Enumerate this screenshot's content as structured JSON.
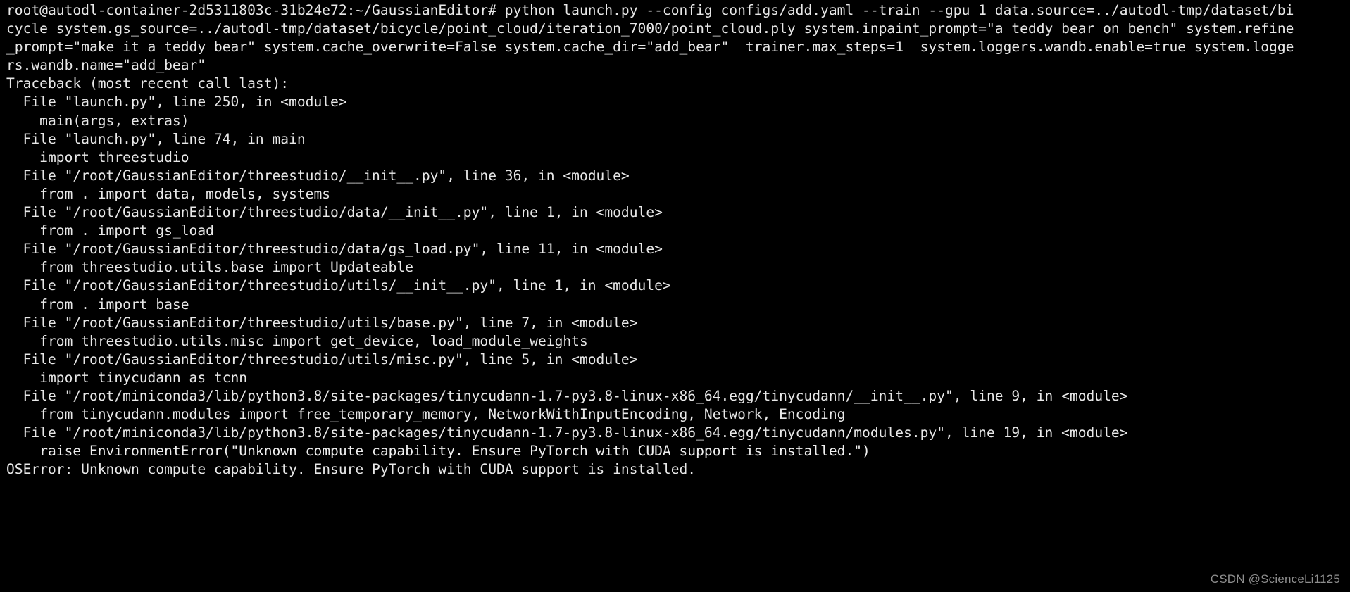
{
  "terminal": {
    "background_color": "#000000",
    "text_color": "#e8e8e8",
    "prompt": "root@autodl-container-2d5311803c-31b24e72:~/GaussianEditor#",
    "lines": [
      "root@autodl-container-2d5311803c-31b24e72:~/GaussianEditor# python launch.py --config configs/add.yaml --train --gpu 1 data.source=../autodl-tmp/dataset/bi",
      "cycle system.gs_source=../autodl-tmp/dataset/bicycle/point_cloud/iteration_7000/point_cloud.ply system.inpaint_prompt=\"a teddy bear on bench\" system.refine",
      "_prompt=\"make it a teddy bear\" system.cache_overwrite=False system.cache_dir=\"add_bear\"  trainer.max_steps=1  system.loggers.wandb.enable=true system.logge",
      "rs.wandb.name=\"add_bear\"",
      "Traceback (most recent call last):",
      "  File \"launch.py\", line 250, in <module>",
      "    main(args, extras)",
      "  File \"launch.py\", line 74, in main",
      "    import threestudio",
      "  File \"/root/GaussianEditor/threestudio/__init__.py\", line 36, in <module>",
      "    from . import data, models, systems",
      "  File \"/root/GaussianEditor/threestudio/data/__init__.py\", line 1, in <module>",
      "    from . import gs_load",
      "  File \"/root/GaussianEditor/threestudio/data/gs_load.py\", line 11, in <module>",
      "    from threestudio.utils.base import Updateable",
      "  File \"/root/GaussianEditor/threestudio/utils/__init__.py\", line 1, in <module>",
      "    from . import base",
      "  File \"/root/GaussianEditor/threestudio/utils/base.py\", line 7, in <module>",
      "    from threestudio.utils.misc import get_device, load_module_weights",
      "  File \"/root/GaussianEditor/threestudio/utils/misc.py\", line 5, in <module>",
      "    import tinycudann as tcnn",
      "  File \"/root/miniconda3/lib/python3.8/site-packages/tinycudann-1.7-py3.8-linux-x86_64.egg/tinycudann/__init__.py\", line 9, in <module>",
      "    from tinycudann.modules import free_temporary_memory, NetworkWithInputEncoding, Network, Encoding",
      "  File \"/root/miniconda3/lib/python3.8/site-packages/tinycudann-1.7-py3.8-linux-x86_64.egg/tinycudann/modules.py\", line 19, in <module>",
      "    raise EnvironmentError(\"Unknown compute capability. Ensure PyTorch with CUDA support is installed.\")",
      "OSError: Unknown compute capability. Ensure PyTorch with CUDA support is installed."
    ],
    "error_line_index": 24,
    "command": {
      "program": "python",
      "script": "launch.py",
      "config_flag": "--config",
      "config_value": "configs/add.yaml",
      "train_flag": "--train",
      "gpu_flag": "--gpu",
      "gpu_value": "1",
      "overrides": [
        "data.source=../autodl-tmp/dataset/bicycle",
        "system.gs_source=../autodl-tmp/dataset/bicycle/point_cloud/iteration_7000/point_cloud.ply",
        "system.inpaint_prompt=\"a teddy bear on bench\"",
        "system.refine_prompt=\"make it a teddy bear\"",
        "system.cache_overwrite=False",
        "system.cache_dir=\"add_bear\"",
        "trainer.max_steps=1",
        "system.loggers.wandb.enable=true",
        "system.loggers.wandb.name=\"add_bear\""
      ]
    },
    "traceback": {
      "header": "Traceback (most recent call last):",
      "frames": [
        {
          "file": "launch.py",
          "line": "250",
          "scope": "<module>",
          "code": "main(args, extras)"
        },
        {
          "file": "launch.py",
          "line": "74",
          "scope": "main",
          "code": "import threestudio"
        },
        {
          "file": "/root/GaussianEditor/threestudio/__init__.py",
          "line": "36",
          "scope": "<module>",
          "code": "from . import data, models, systems"
        },
        {
          "file": "/root/GaussianEditor/threestudio/data/__init__.py",
          "line": "1",
          "scope": "<module>",
          "code": "from . import gs_load"
        },
        {
          "file": "/root/GaussianEditor/threestudio/data/gs_load.py",
          "line": "11",
          "scope": "<module>",
          "code": "from threestudio.utils.base import Updateable"
        },
        {
          "file": "/root/GaussianEditor/threestudio/utils/__init__.py",
          "line": "1",
          "scope": "<module>",
          "code": "from . import base"
        },
        {
          "file": "/root/GaussianEditor/threestudio/utils/base.py",
          "line": "7",
          "scope": "<module>",
          "code": "from threestudio.utils.misc import get_device, load_module_weights"
        },
        {
          "file": "/root/GaussianEditor/threestudio/utils/misc.py",
          "line": "5",
          "scope": "<module>",
          "code": "import tinycudann as tcnn"
        },
        {
          "file": "/root/miniconda3/lib/python3.8/site-packages/tinycudann-1.7-py3.8-linux-x86_64.egg/tinycudann/__init__.py",
          "line": "9",
          "scope": "<module>",
          "code": "from tinycudann.modules import free_temporary_memory, NetworkWithInputEncoding, Network, Encoding"
        },
        {
          "file": "/root/miniconda3/lib/python3.8/site-packages/tinycudann-1.7-py3.8-linux-x86_64.egg/tinycudann/modules.py",
          "line": "19",
          "scope": "<module>",
          "code": "raise EnvironmentError(\"Unknown compute capability. Ensure PyTorch with CUDA support is installed.\")"
        }
      ],
      "exception_type": "OSError",
      "exception_message": "Unknown compute capability. Ensure PyTorch with CUDA support is installed."
    }
  },
  "watermark": {
    "text": "CSDN @ScienceLi1125",
    "color": "#8e8e8e"
  }
}
